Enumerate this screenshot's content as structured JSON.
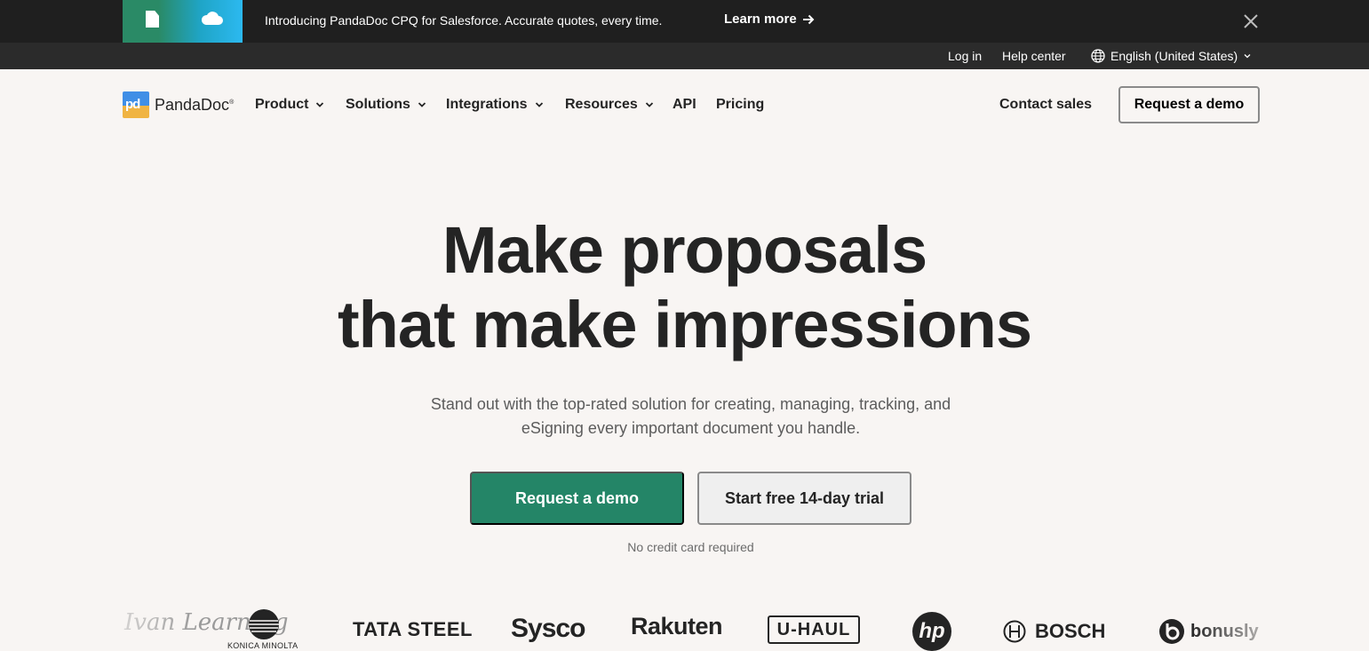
{
  "promo": {
    "text": "Introducing PandaDoc CPQ for Salesforce. Accurate quotes, every time.",
    "link_label": "Learn more",
    "icons": [
      "document-icon",
      "cloud-icon",
      "arrow-right-icon",
      "close-icon"
    ]
  },
  "utility": {
    "login": "Log in",
    "help": "Help center",
    "language": "English (United States)"
  },
  "nav": {
    "brand": "PandaDoc",
    "items": [
      {
        "label": "Product",
        "dropdown": true
      },
      {
        "label": "Solutions",
        "dropdown": true
      },
      {
        "label": "Integrations",
        "dropdown": true
      },
      {
        "label": "Resources",
        "dropdown": true
      },
      {
        "label": "API",
        "dropdown": false
      },
      {
        "label": "Pricing",
        "dropdown": false
      }
    ],
    "contact": "Contact sales",
    "demo": "Request a demo"
  },
  "hero": {
    "title_line1": "Make proposals",
    "title_line2": "that make impressions",
    "subtitle": "Stand out with the top-rated solution for creating, managing, tracking, and eSigning every important document you handle.",
    "primary_cta": "Request a demo",
    "secondary_cta": "Start free 14-day trial",
    "note": "No credit card required"
  },
  "customers": {
    "logos": [
      "Ivan Learning",
      "KONICA MINOLTA",
      "TATA STEEL",
      "Sysco",
      "Rakuten",
      "U-HAUL",
      "hp",
      "BOSCH",
      "bonusly"
    ]
  },
  "colors": {
    "primary_green": "#248567",
    "banner_bg": "#1f1f1f",
    "utility_bg": "#2b2b2b",
    "page_bg": "#f8f5f3"
  }
}
